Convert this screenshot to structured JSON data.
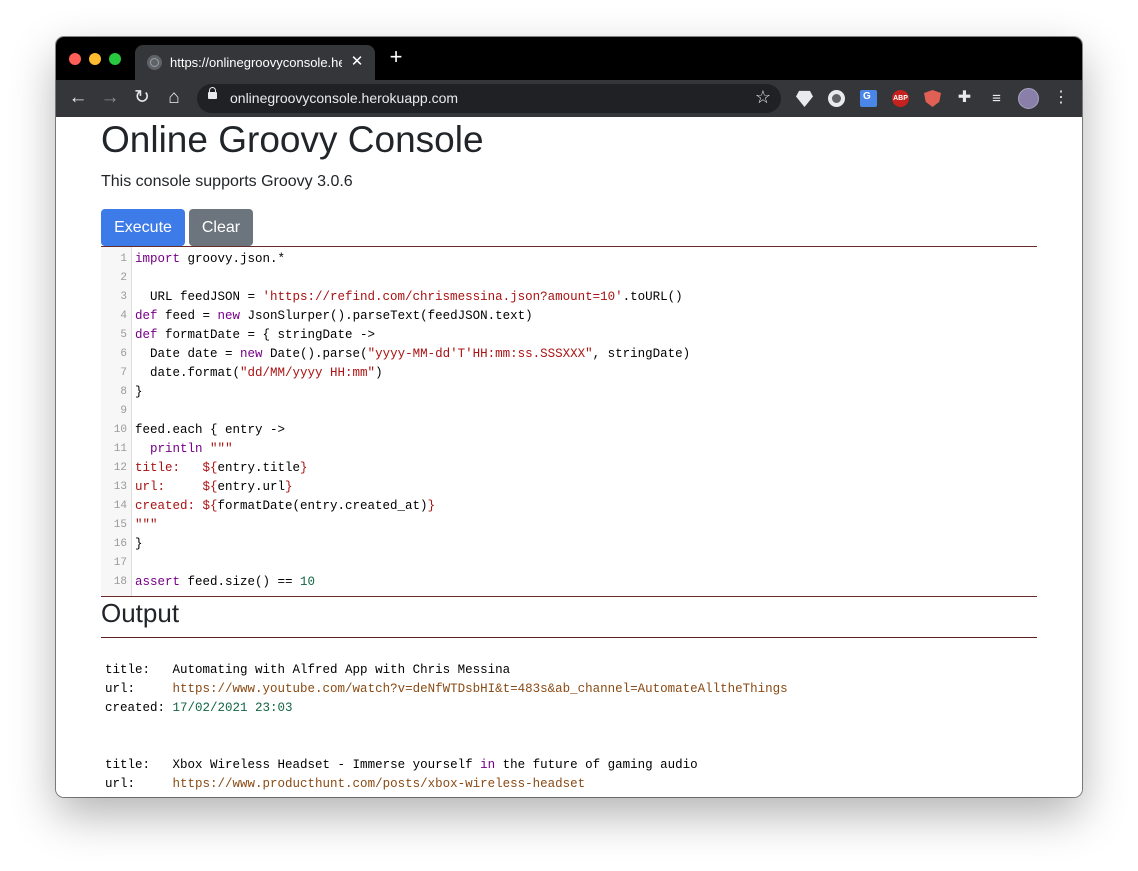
{
  "browser": {
    "tab_title": "https://onlinegroovyconsole.herokuapp.com",
    "tab_close": "✕",
    "new_tab": "+",
    "address": "onlinegroovyconsole.herokuapp.com",
    "nav": {
      "back": "←",
      "forward": "→",
      "reload": "↻",
      "home": "⌂"
    },
    "star": "☆",
    "extensions": [
      "gem-icon",
      "circle-record-icon",
      "google-translate-icon",
      "adblock-plus-icon",
      "shield-icon",
      "puzzle-extension-icon",
      "media-queue-icon"
    ],
    "ext_labels": {
      "abp": "ABP",
      "puzzle": "✚",
      "queue": "≡"
    },
    "menu": "⋮"
  },
  "page": {
    "title": "Online Groovy Console",
    "subtitle": "This console supports Groovy 3.0.6",
    "execute_label": "Execute",
    "clear_label": "Clear",
    "output_heading": "Output"
  },
  "editor": {
    "line_numbers": [
      "1",
      "2",
      "3",
      "4",
      "5",
      "6",
      "7",
      "8",
      "9",
      "10",
      "11",
      "12",
      "13",
      "14",
      "15",
      "16",
      "17",
      "18"
    ],
    "lines": [
      "import groovy.json.*",
      "",
      "  URL feedJSON = 'https://refind.com/chrismessina.json?amount=10'.toURL()",
      "def feed = new JsonSlurper().parseText(feedJSON.text)",
      "def formatDate = { stringDate ->",
      "  Date date = new Date().parse(\"yyyy-MM-dd'T'HH:mm:ss.SSSXXX\", stringDate)",
      "  date.format(\"dd/MM/yyyy HH:mm\")",
      "}",
      "",
      "feed.each { entry ->",
      "  println \"\"\"",
      "title:   ${entry.title}",
      "url:     ${entry.url}",
      "created: ${formatDate(entry.created_at)}",
      "\"\"\"",
      "}",
      "",
      "assert feed.size() == 10"
    ]
  },
  "output": {
    "entries": [
      {
        "title_label": "title:",
        "title": "Automating with Alfred App with Chris Messina",
        "url_label": "url:",
        "url": "https://www.youtube.com/watch?v=deNfWTDsbHI&t=483s&ab_channel=AutomateAlltheThings",
        "created_label": "created:",
        "created": "17/02/2021 23:03"
      },
      {
        "title_label": "title:",
        "title": "Xbox Wireless Headset - Immerse yourself in the future of gaming audio",
        "url_label": "url:",
        "url": "https://www.producthunt.com/posts/xbox-wireless-headset"
      }
    ]
  },
  "colors": {
    "keyword": "#770088",
    "string": "#aa1111",
    "number": "#116644",
    "execute_button": "#3d7be8",
    "clear_button": "#6c757d"
  }
}
